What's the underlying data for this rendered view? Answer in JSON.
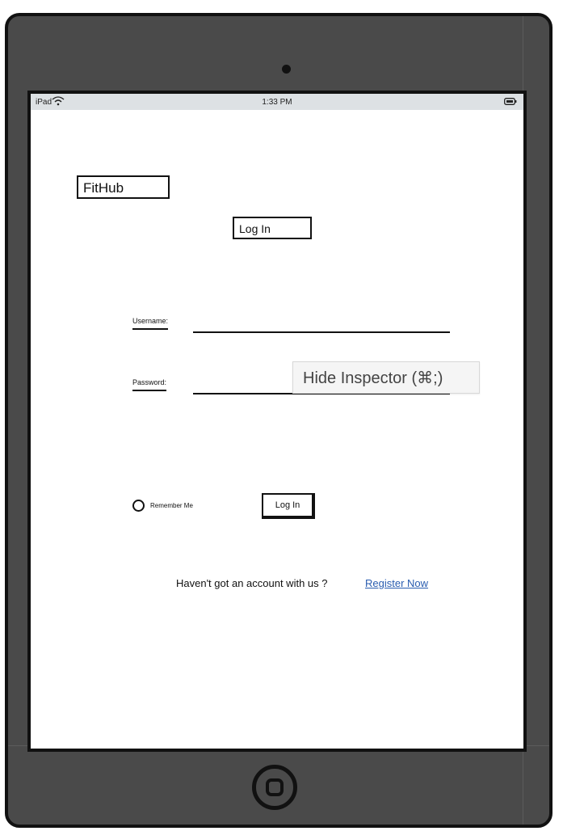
{
  "status_bar": {
    "carrier": "iPad",
    "time": "1:33 PM"
  },
  "app": {
    "logo": "FitHub",
    "heading": "Log In"
  },
  "form": {
    "username_label": "Username:",
    "password_label": "Password:",
    "remember_label": "Remember Me",
    "login_button": "Log In"
  },
  "register": {
    "prompt": "Haven't got an account with us ?",
    "link": "Register Now"
  },
  "tooltip": {
    "text": "Hide Inspector (⌘;)"
  },
  "icons": [
    "wifi-icon",
    "battery-icon",
    "camera",
    "home-button"
  ],
  "colors": {
    "frame": "#4a4a4a",
    "status_bar": "#dde1e4",
    "link": "#2a5db0"
  }
}
